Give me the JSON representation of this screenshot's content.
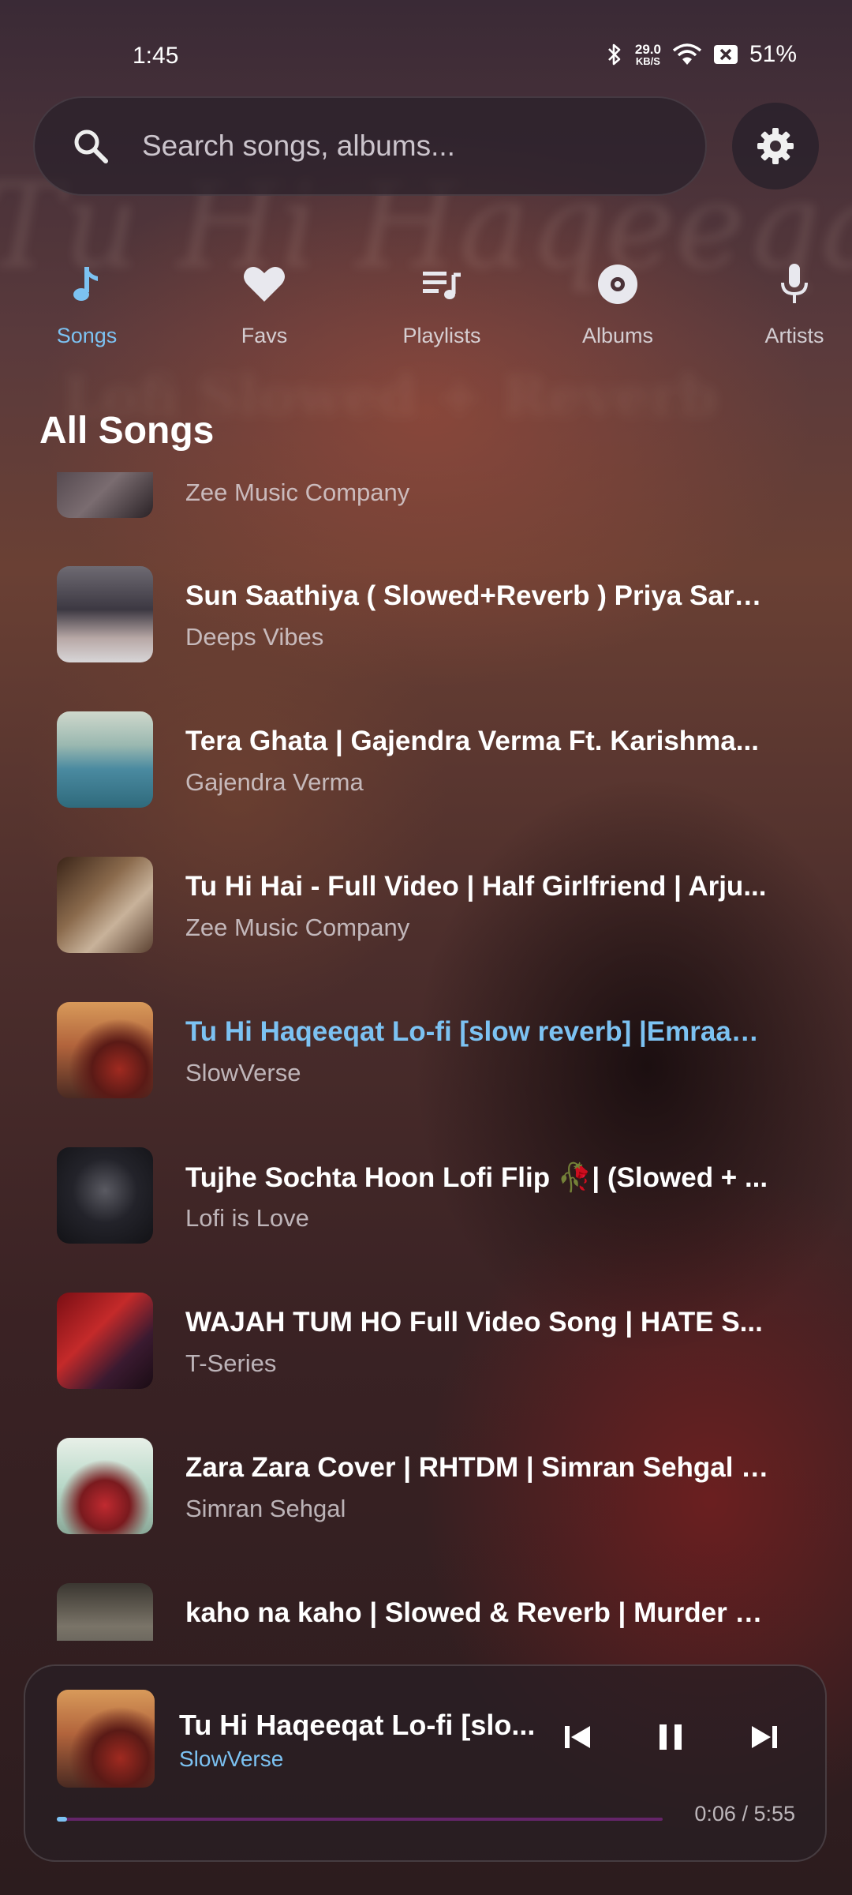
{
  "status_bar": {
    "time": "1:45",
    "net_speed_value": "29.0",
    "net_speed_unit": "KB/S",
    "battery": "51%"
  },
  "search": {
    "placeholder": "Search songs, albums..."
  },
  "tabs": [
    {
      "label": "Songs",
      "icon": "music-note-icon",
      "active": true
    },
    {
      "label": "Favs",
      "icon": "heart-icon",
      "active": false
    },
    {
      "label": "Playlists",
      "icon": "playlist-icon",
      "active": false
    },
    {
      "label": "Albums",
      "icon": "album-icon",
      "active": false
    },
    {
      "label": "Artists",
      "icon": "microphone-icon",
      "active": false
    }
  ],
  "section_title": "All Songs",
  "songs": [
    {
      "title": "",
      "artist": "Zee Music Company"
    },
    {
      "title": "Sun Saathiya ( Slowed+Reverb ) Priya Sara...",
      "artist": "Deeps Vibes"
    },
    {
      "title": "Tera Ghata | Gajendra Verma Ft. Karishma...",
      "artist": "Gajendra Verma"
    },
    {
      "title": "Tu Hi Hai - Full Video | Half Girlfriend | Arju...",
      "artist": "Zee Music Company"
    },
    {
      "title": "Tu Hi Haqeeqat Lo-fi [slow reverb] |Emraan...",
      "artist": "SlowVerse"
    },
    {
      "title": "Tujhe Sochta Hoon Lofi Flip 🥀| (Slowed + ...",
      "artist": "Lofi is Love"
    },
    {
      "title": "WAJAH TUM HO Full Video Song | HATE S...",
      "artist": "T-Series"
    },
    {
      "title": "Zara Zara Cover | RHTDM | Simran Sehgal |...",
      "artist": "Simran Sehgal"
    },
    {
      "title": "kaho na kaho | Slowed & Reverb | Murder | ...",
      "artist": ""
    }
  ],
  "now_playing": {
    "title": "Tu Hi Haqeeqat Lo-fi [slo...",
    "artist": "SlowVerse",
    "time": "0:06 / 5:55",
    "progress": 0.017
  },
  "colors": {
    "accent": "#7cc2f2",
    "progress_track": "#7a2882"
  }
}
